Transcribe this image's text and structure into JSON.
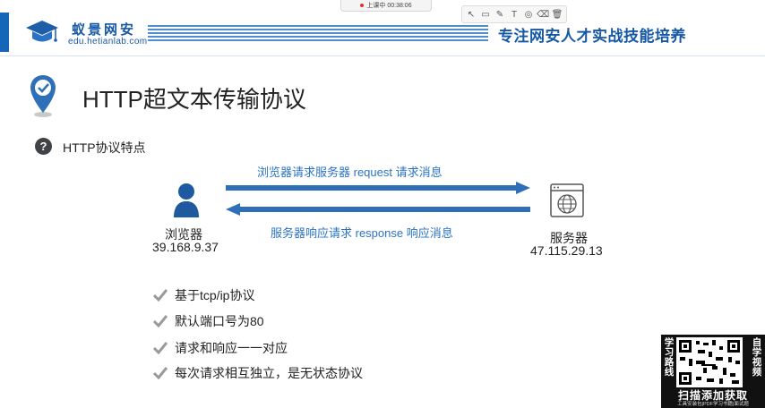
{
  "toolbar": {
    "share_text": "上课中 00:38:06"
  },
  "header": {
    "brand_cn": "蚁景网安",
    "brand_url": "edu.hetianlab.com",
    "slogan": "专注网安人才实战技能培养"
  },
  "slide": {
    "title": "HTTP超文本传输协议",
    "subtitle": "HTTP协议特点",
    "request_label": "浏览器请求服务器   request    请求消息",
    "response_label": "服务器响应请求  response  响应消息",
    "browser": {
      "label": "浏览器",
      "ip": "39.168.9.37"
    },
    "server": {
      "label": "服务器",
      "ip": "47.115.29.13"
    },
    "features": [
      "基于tcp/ip协议",
      "默认端口号为80",
      "请求和响应一一对应",
      "每次请求相互独立，是无状态协议"
    ]
  },
  "qr_panel": {
    "left_text": "学习路线",
    "right_text": "自学视频",
    "caption": "扫描添加获取",
    "sub": "工具安装包|PDF学习书籍|面试题"
  },
  "colors": {
    "brand_blue": "#1558a6",
    "arrow_blue": "#2f6fb8",
    "label_blue": "#2a73c4"
  }
}
